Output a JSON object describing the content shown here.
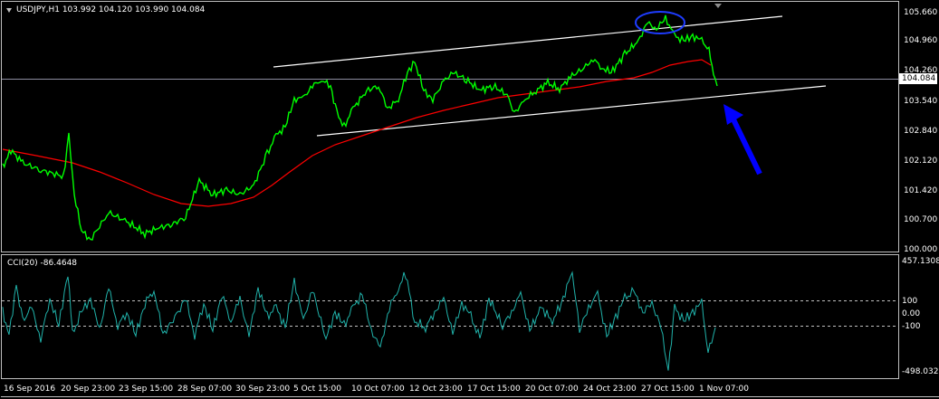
{
  "header": {
    "symbol_info": "USDJPY,H1  103.992 104.120 103.990 104.084"
  },
  "price_axis": {
    "labels": [
      "105.660",
      "104.960",
      "104.260",
      "103.540",
      "102.840",
      "102.120",
      "101.420",
      "100.700",
      "100.000"
    ],
    "current_price": "104.084"
  },
  "indicator": {
    "title": "CCI(20) -86.4648",
    "axis_labels": [
      "457.1308",
      "100",
      "0.00",
      "-100",
      "-498.0328"
    ]
  },
  "time_axis": {
    "labels": [
      "16 Sep 2016",
      "20 Sep 23:00",
      "23 Sep 15:00",
      "28 Sep 07:00",
      "30 Sep 23:00",
      "5 Oct 15:00",
      "10 Oct 07:00",
      "12 Oct 23:00",
      "17 Oct 15:00",
      "20 Oct 07:00",
      "24 Oct 23:00",
      "27 Oct 15:00",
      "1 Nov 07:00"
    ]
  },
  "colors": {
    "background": "#000000",
    "price_line": "#00ff00",
    "moving_average": "#ff0000",
    "cci_line": "#20b2aa",
    "channel": "#ffffff",
    "annotation_arrow": "#0000ff",
    "annotation_ellipse": "#1e3cff"
  }
}
